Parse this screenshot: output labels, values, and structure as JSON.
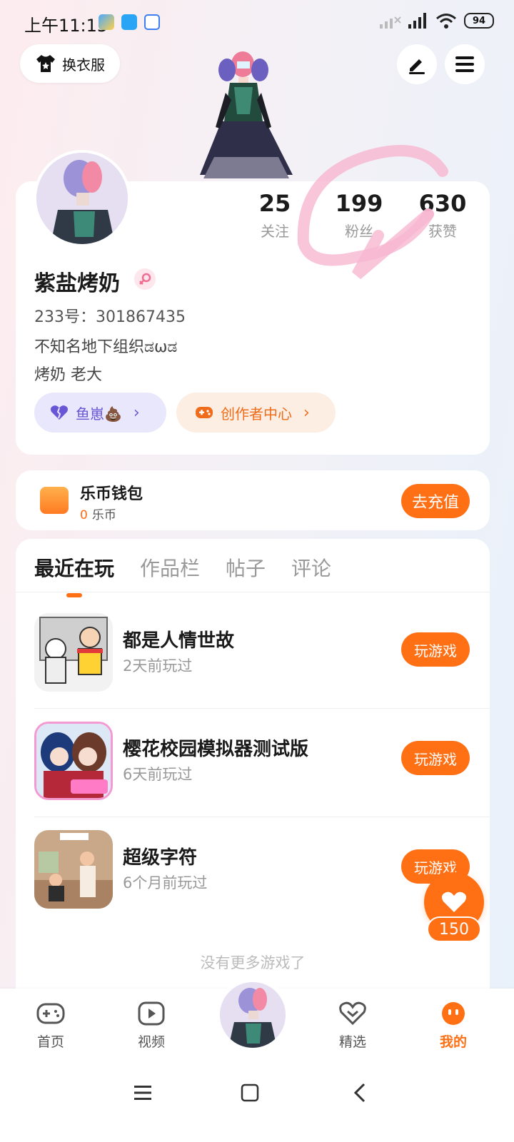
{
  "status_bar": {
    "time": "上午11:15",
    "battery": "94"
  },
  "header": {
    "outfit_label": "换衣服",
    "edit_icon": "pen-icon",
    "menu_icon": "hamburger-menu-icon"
  },
  "profile": {
    "stats": [
      {
        "value": "25",
        "label": "关注"
      },
      {
        "value": "199",
        "label": "粉丝"
      },
      {
        "value": "630",
        "label": "获赞"
      }
    ],
    "username": "紫盐烤奶",
    "user_id": "233号：301867435",
    "bio_line_1": "不知名地下组织ಡωಡ",
    "bio_line_2": "烤奶 老大",
    "fan_tag": "鱼崽💩",
    "creator_tag": "创作者中心"
  },
  "wallet": {
    "title": "乐币钱包",
    "amount": "0",
    "unit": "乐币",
    "recharge_label": "去充值"
  },
  "tabs": [
    {
      "label": "最近在玩",
      "active": true
    },
    {
      "label": "作品栏",
      "active": false
    },
    {
      "label": "帖子",
      "active": false
    },
    {
      "label": "评论",
      "active": false
    }
  ],
  "games": [
    {
      "title": "都是人情世故",
      "subtitle": "2天前玩过",
      "button": "玩游戏"
    },
    {
      "title": "樱花校园模拟器测试版",
      "subtitle": "6天前玩过",
      "button": "玩游戏"
    },
    {
      "title": "超级字符",
      "subtitle": "6个月前玩过",
      "button": "玩游戏"
    }
  ],
  "list_end_text": "没有更多游戏了",
  "like": {
    "count": "150"
  },
  "bottom_nav": [
    {
      "label": "首页",
      "icon": "gamepad-icon",
      "active": false
    },
    {
      "label": "视频",
      "icon": "video-play-icon",
      "active": false
    },
    {
      "label": "精选",
      "icon": "heart-badge-icon",
      "active": false
    },
    {
      "label": "我的",
      "icon": "smiley-profile-icon",
      "active": true
    }
  ],
  "colors": {
    "accent": "#ff6f14",
    "fan_tag": "#6756d6",
    "creator_tag": "#ef6c1a"
  }
}
